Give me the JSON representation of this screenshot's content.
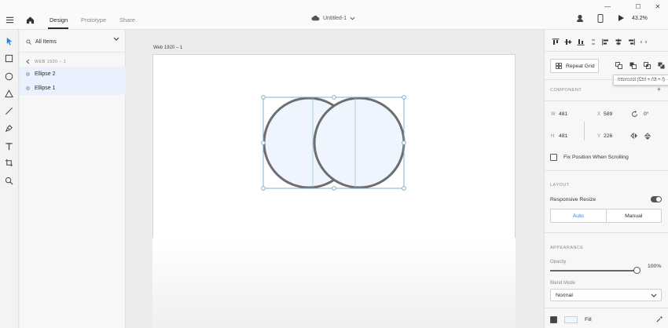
{
  "topbar": {
    "tabs": [
      "Design",
      "Prototype",
      "Share"
    ],
    "document_title": "Untitled-1",
    "zoom": "43.2%"
  },
  "layers": {
    "filter_label": "All Items",
    "artboard_label": "WEB 1920 – 1",
    "items": [
      {
        "label": "Ellipse 2"
      },
      {
        "label": "Ellipse 1"
      }
    ]
  },
  "canvas": {
    "artboard_name": "Web 1920 – 1"
  },
  "props": {
    "repeat_grid": "Repeat Grid",
    "tooltip": "Intersect (Ctrl + Alt + I)",
    "component_title": "COMPONENT",
    "w_label": "W",
    "w_value": "481",
    "h_label": "H",
    "h_value": "481",
    "x_label": "X",
    "x_value": "589",
    "y_label": "Y",
    "y_value": "226",
    "rotation": "0°",
    "fix_position": "Fix Position When Scrolling",
    "layout_title": "LAYOUT",
    "responsive_resize": "Responsive Resize",
    "auto_label": "Auto",
    "manual_label": "Manual",
    "appearance_title": "APPEARANCE",
    "opacity_label": "Opacity",
    "opacity_value": "100%",
    "blend_label": "Blend Mode",
    "blend_value": "Normal",
    "fill_label": "Fill"
  },
  "colors": {
    "accent": "#2680eb",
    "selection": "#70a8c8",
    "shape_fill": "#eff5ff",
    "shape_stroke": "#6e6e6e"
  }
}
